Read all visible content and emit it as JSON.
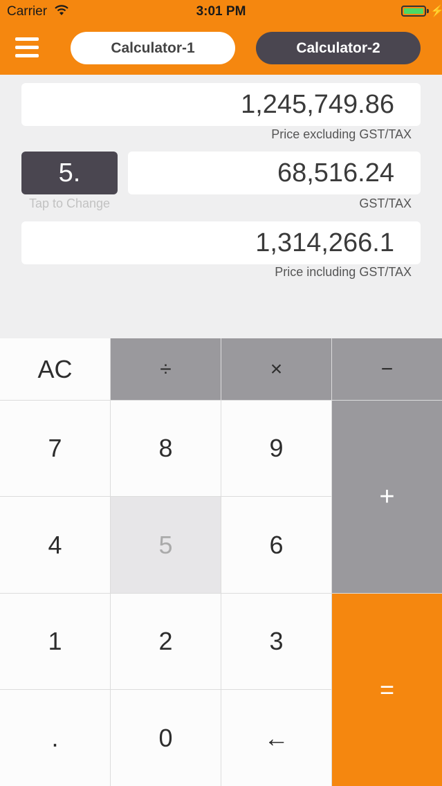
{
  "status": {
    "carrier": "Carrier",
    "time": "3:01 PM"
  },
  "header": {
    "tab1": "Calculator-1",
    "tab2": "Calculator-2"
  },
  "display": {
    "price_excl": "1,245,749.86",
    "price_excl_label": "Price excluding GST/TAX",
    "rate": "5.",
    "rate_hint": "Tap to Change",
    "tax": "68,516.24",
    "tax_label": "GST/TAX",
    "price_incl": "1,314,266.1",
    "price_incl_label": "Price including GST/TAX"
  },
  "keys": {
    "ac": "AC",
    "divide": "÷",
    "multiply": "×",
    "minus": "−",
    "plus": "+",
    "equals": "=",
    "k7": "7",
    "k8": "8",
    "k9": "9",
    "k4": "4",
    "k5": "5",
    "k6": "6",
    "k1": "1",
    "k2": "2",
    "k3": "3",
    "dot": ".",
    "k0": "0",
    "back": "←"
  },
  "colors": {
    "accent": "#f5870f",
    "dark": "#4a4650",
    "operator_gray": "#9a999d"
  }
}
